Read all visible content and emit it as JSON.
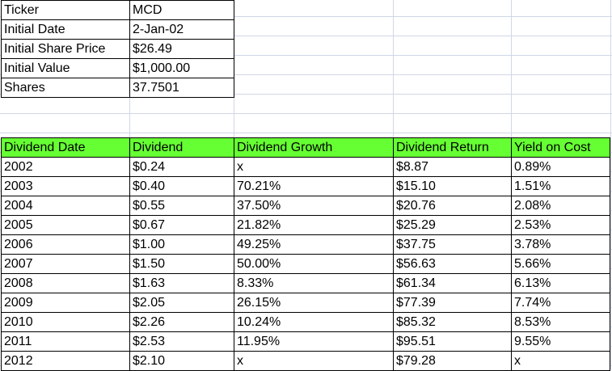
{
  "info_rows": [
    {
      "label": "Ticker",
      "value": "MCD"
    },
    {
      "label": "Initial Date",
      "value": "2-Jan-02"
    },
    {
      "label": "Initial Share Price",
      "value": "$26.49"
    },
    {
      "label": "Initial Value",
      "value": "$1,000.00"
    },
    {
      "label": "Shares",
      "value": "37.7501"
    }
  ],
  "dividend_table": {
    "header_color": "#66ff33",
    "headers": [
      "Dividend Date",
      "Dividend",
      "Dividend Growth",
      "Dividend Return",
      "Yield on Cost"
    ],
    "rows": [
      [
        "2002",
        "$0.24",
        "x",
        "$8.87",
        "0.89%"
      ],
      [
        "2003",
        "$0.40",
        "70.21%",
        "$15.10",
        "1.51%"
      ],
      [
        "2004",
        "$0.55",
        "37.50%",
        "$20.76",
        "2.08%"
      ],
      [
        "2005",
        "$0.67",
        "21.82%",
        "$25.29",
        "2.53%"
      ],
      [
        "2006",
        "$1.00",
        "49.25%",
        "$37.75",
        "3.78%"
      ],
      [
        "2007",
        "$1.50",
        "50.00%",
        "$56.63",
        "5.66%"
      ],
      [
        "2008",
        "$1.63",
        "8.33%",
        "$61.34",
        "6.13%"
      ],
      [
        "2009",
        "$2.05",
        "26.15%",
        "$77.39",
        "7.74%"
      ],
      [
        "2010",
        "$2.26",
        "10.24%",
        "$85.32",
        "8.53%"
      ],
      [
        "2011",
        "$2.53",
        "11.95%",
        "$95.51",
        "9.55%"
      ],
      [
        "2012",
        "$2.10",
        "x",
        "$79.28",
        "x"
      ]
    ]
  }
}
